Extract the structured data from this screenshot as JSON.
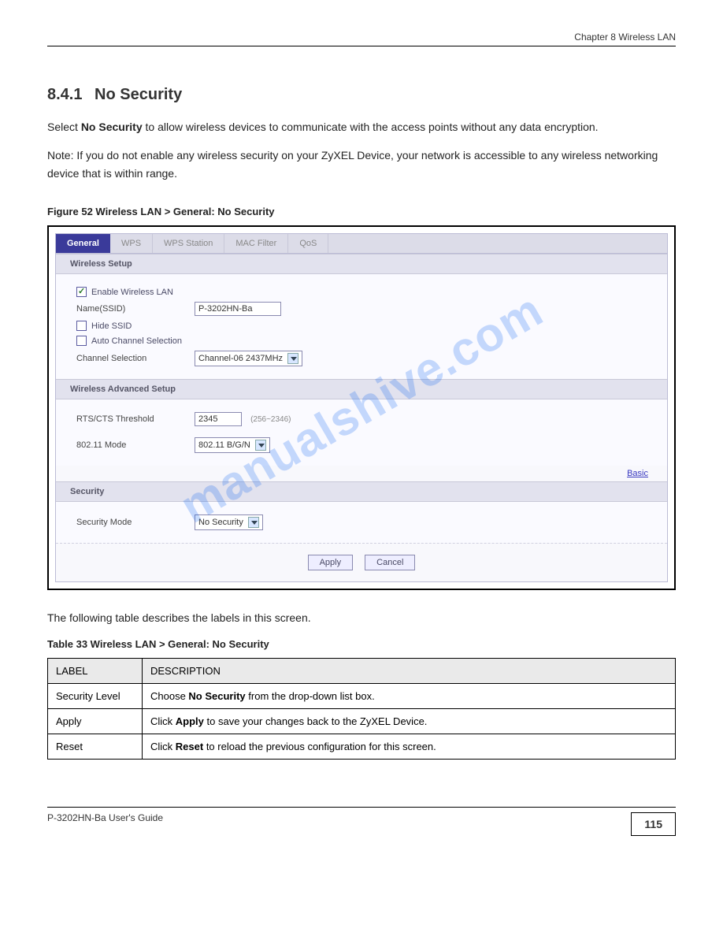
{
  "header_line": "Chapter 8 Wireless LAN",
  "section_number": "8.4.1",
  "section_title": "No Security",
  "para1_pre": "Select ",
  "para1_bold": "No Security",
  "para1_post": " to allow wireless devices to communicate with the access points without any data encryption.",
  "para2": "Note: If you do not enable any wireless security on your ZyXEL Device, your network is accessible to any wireless networking device that is within range.",
  "figure_caption": "Figure 52   Wireless LAN > General: No Security",
  "watermark": "manualshive.com",
  "tabs": [
    {
      "label": "General",
      "active": true
    },
    {
      "label": "WPS",
      "active": false
    },
    {
      "label": "WPS Station",
      "active": false
    },
    {
      "label": "MAC Filter",
      "active": false
    },
    {
      "label": "QoS",
      "active": false
    }
  ],
  "wireless_setup": {
    "header": "Wireless Setup",
    "enable_wlan": {
      "checked": true,
      "label": "Enable Wireless LAN"
    },
    "name_ssid_label": "Name(SSID)",
    "name_ssid_value": "P-3202HN-Ba",
    "hide_ssid": {
      "checked": false,
      "label": "Hide SSID"
    },
    "auto_channel": {
      "checked": false,
      "label": "Auto Channel Selection"
    },
    "channel_label": "Channel Selection",
    "channel_value": "Channel-06 2437MHz"
  },
  "wireless_advanced": {
    "header": "Wireless Advanced Setup",
    "rts_label": "RTS/CTS Threshold",
    "rts_value": "2345",
    "rts_hint": "(256~2346)",
    "mode_label": "802.11 Mode",
    "mode_value": "802.11 B/G/N",
    "basic_link": "Basic"
  },
  "security": {
    "header": "Security",
    "mode_label": "Security Mode",
    "mode_value": "No Security"
  },
  "buttons": {
    "apply": "Apply",
    "cancel": "Cancel"
  },
  "table_intro": "The following table describes the labels in this screen.",
  "table_caption": "Table 33   Wireless LAN > General: No Security",
  "table_head_label": "LABEL",
  "table_head_desc": "DESCRIPTION",
  "table_rows": [
    {
      "label": "Security Level",
      "desc": "Choose No Security from the drop-down list box."
    },
    {
      "label": "Apply",
      "desc": "Click Apply to save your changes back to the ZyXEL Device."
    },
    {
      "label": "Reset",
      "desc": "Click Reset to reload the previous configuration for this screen."
    }
  ],
  "footer_text": "P-3202HN-Ba User's Guide",
  "page_number": "115"
}
